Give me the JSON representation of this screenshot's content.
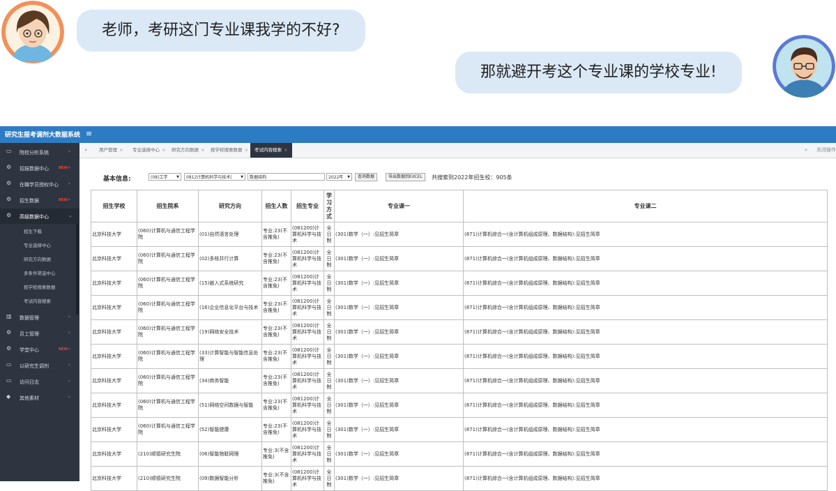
{
  "chat": {
    "messages": [
      {
        "side": "left",
        "text": "老师，考研这门专业课我学的不好?"
      },
      {
        "side": "right",
        "text": "那就避开考这个专业课的学校专业!"
      }
    ]
  },
  "app": {
    "title": "研究生报考调剂大数据系统",
    "menu_icon": "menu-icon",
    "sidebar": [
      {
        "label": "院校分析系统",
        "icon": "monitor-icon"
      },
      {
        "label": "招报数据中心",
        "icon": "gears-icon",
        "badge": "NEW"
      },
      {
        "label": "在職学员授权中心",
        "icon": "gears-icon"
      },
      {
        "label": "招生数据",
        "icon": "gears-icon",
        "badge": "NEW"
      },
      {
        "label": "高级数据中心",
        "icon": "gears-icon",
        "active": true
      },
      {
        "label": "数据管理",
        "icon": "chart-icon"
      },
      {
        "label": "员工管理",
        "icon": "gears-icon"
      },
      {
        "label": "学堂中心",
        "icon": "gears-icon",
        "badge": "NEW"
      },
      {
        "label": "以研究生调剂",
        "icon": "monitor-icon"
      },
      {
        "label": "访问日志",
        "icon": "monitor-icon"
      },
      {
        "label": "其他素材",
        "icon": "tag-icon"
      }
    ],
    "submenu": [
      "招生下载",
      "专业选择中心",
      "研究方向数据",
      "多条件筛选中心",
      "按学校搜索数据",
      "考试内容搜索"
    ],
    "tabs": [
      "用户管理",
      "专业选择中心",
      "研究方向数据",
      "按学校搜索数据",
      "考试内容搜索"
    ],
    "active_tab": 4,
    "right_label": "关闭操作"
  },
  "filter": {
    "label": "基本信息:",
    "field1": "(08)工学",
    "field2": "0812计算机科学与技术(",
    "field3": "数据结构",
    "year": "2022年",
    "search": "查询数据",
    "export": "导出数据到EXCEL",
    "summary": "共搜索到2022年招生校：905条"
  },
  "table": {
    "headers": [
      "招生学校",
      "招生院系",
      "研究方向",
      "招生人数",
      "招生专业",
      "学习方式",
      "专业课一",
      "专业课二"
    ],
    "rows": [
      {
        "school": "北京科技大学",
        "dept": "(060)计算机与通信工程学院",
        "dir": "(01)自然语言处理",
        "num": "专业:23(不含推免)",
        "major": "(081200)计算机科学与技术",
        "mode": "全日制",
        "c1": "(301)数学（一）:见招生简章",
        "c2": "(871)计算机综合一(含计算机组成原理、数据结构):见招生简章"
      },
      {
        "school": "北京科技大学",
        "dept": "(060)计算机与通信工程学院",
        "dir": "(02)多核并行计算",
        "num": "专业:23(不含推免)",
        "major": "(081200)计算机科学与技术",
        "mode": "全日制",
        "c1": "(301)数学（一）:见招生简章",
        "c2": "(871)计算机综合一(含计算机组成原理、数据结构):见招生简章"
      },
      {
        "school": "北京科技大学",
        "dept": "(060)计算机与通信工程学院",
        "dir": "(15)嵌入式系统研究",
        "num": "专业:23(不含推免)",
        "major": "(081200)计算机科学与技术",
        "mode": "全日制",
        "c1": "(301)数学（一）:见招生简章",
        "c2": "(871)计算机综合一(含计算机组成原理、数据结构):见招生简章"
      },
      {
        "school": "北京科技大学",
        "dept": "(060)计算机与通信工程学院",
        "dir": "(16)企业信息化平台与技术",
        "num": "专业:23(不含推免)",
        "major": "(081200)计算机科学与技术",
        "mode": "全日制",
        "c1": "(301)数学（一）:见招生简章",
        "c2": "(871)计算机综合一(含计算机组成原理、数据结构):见招生简章"
      },
      {
        "school": "北京科技大学",
        "dept": "(060)计算机与通信工程学院",
        "dir": "(19)网络安全技术",
        "num": "专业:23(不含推免)",
        "major": "(081200)计算机科学与技术",
        "mode": "全日制",
        "c1": "(301)数学（一）:见招生简章",
        "c2": "(871)计算机综合一(含计算机组成原理、数据结构):见招生简章"
      },
      {
        "school": "北京科技大学",
        "dept": "(060)计算机与通信工程学院",
        "dir": "(33)计算智能与智能信息处理",
        "num": "专业:23(不含推免)",
        "major": "(081200)计算机科学与技术",
        "mode": "全日制",
        "c1": "(301)数学（一）:见招生简章",
        "c2": "(871)计算机综合一(含计算机组成原理、数据结构):见招生简章"
      },
      {
        "school": "北京科技大学",
        "dept": "(060)计算机与通信工程学院",
        "dir": "(34)商务智能",
        "num": "专业:23(不含推免)",
        "major": "(081200)计算机科学与技术",
        "mode": "全日制",
        "c1": "(301)数学（一）:见招生简章",
        "c2": "(871)计算机综合一(含计算机组成原理、数据结构):见招生简章"
      },
      {
        "school": "北京科技大学",
        "dept": "(060)计算机与通信工程学院",
        "dir": "(51)网络空间数据与智能",
        "num": "专业:23(不含推免)",
        "major": "(081200)计算机科学与技术",
        "mode": "全日制",
        "c1": "(301)数学（一）:见招生简章",
        "c2": "(871)计算机综合一(含计算机组成原理、数据结构):见招生简章"
      },
      {
        "school": "北京科技大学",
        "dept": "(060)计算机与通信工程学院",
        "dir": "(52)智能健康",
        "num": "专业:23(不含推免)",
        "major": "(081200)计算机科学与技术",
        "mode": "全日制",
        "c1": "(301)数学（一）:见招生简章",
        "c2": "(871)计算机综合一(含计算机组成原理、数据结构):见招生简章"
      },
      {
        "school": "北京科技大学",
        "dept": "(210)顺德研究生院",
        "dir": "(06)智能物联网理",
        "num": "专业:3(不含推免)",
        "major": "(081200)计算机科学与技术",
        "mode": "全日制",
        "c1": "(301)数学（一）:见招生简章",
        "c2": "(871)计算机综合一(含计算机组成原理、数据结构):见招生简章"
      },
      {
        "school": "北京科技大学",
        "dept": "(210)顺德研究生院",
        "dir": "(09)数据智能分析",
        "num": "专业:3(不含推免)",
        "major": "(081200)计算机科学与技术",
        "mode": "全日制",
        "c1": "(301)数学（一）:见招生简章",
        "c2": "(871)计算机综合一(含计算机组成原理、数据结构):见招生简章"
      }
    ]
  }
}
